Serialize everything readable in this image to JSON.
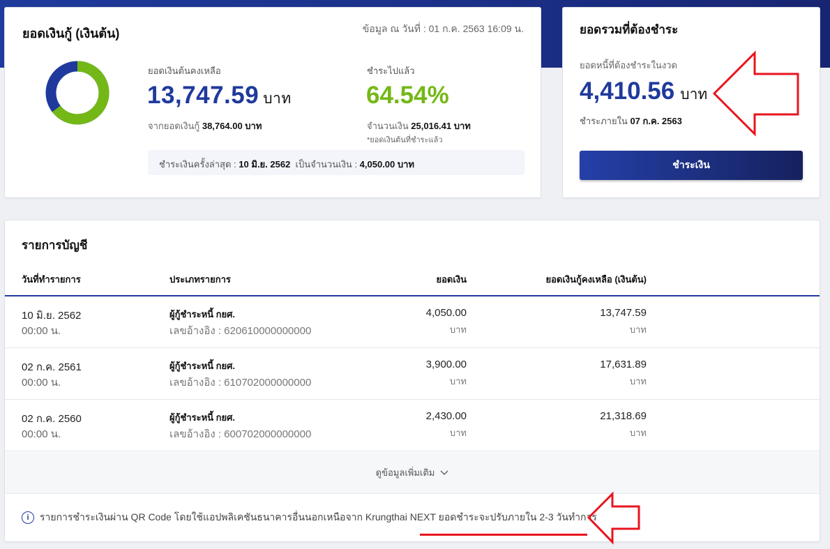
{
  "loan": {
    "title": "ยอดเงินกู้ (เงินต้น)",
    "as_of": "ข้อมูล ณ วันที่ : 01 ก.ค. 2563 16:09 น.",
    "remaining_label": "ยอดเงินต้นคงเหลือ",
    "remaining_amount": "13,747.59",
    "unit": "บาท",
    "from_label": "จากยอดเงินกู้",
    "from_amount": "38,764.00 บาท",
    "paid_label": "ชำระไปแล้ว",
    "paid_percent": "64.54%",
    "paid_fraction": 0.6454,
    "amount_label": "จำนวนเงิน",
    "amount_paid": "25,016.41 บาท",
    "note": "*ยอดเงินต้นที่ชำระแล้ว",
    "last_pay_label": "ชำระเงินครั้งล่าสุด :",
    "last_pay_date": "10 มิ.ย. 2562",
    "last_pay_amount_label": "เป็นจำนวนเงิน :",
    "last_pay_amount": "4,050.00 บาท"
  },
  "colors": {
    "accent": "#1f3a9c",
    "paid": "#74b817",
    "alert": "#e8141e"
  },
  "total": {
    "title": "ยอดรวมที่ต้องชำระ",
    "due_label": "ยอดหนี้ที่ต้องชำระในงวด",
    "amount": "4,410.56",
    "unit": "บาท",
    "due_date_label": "ชำระภายใน",
    "due_date": "07 ก.ค. 2563",
    "pay_button": "ชำระเงิน"
  },
  "transactions": {
    "title": "รายการบัญชี",
    "headers": [
      "วันที่ทำรายการ",
      "ประเภทรายการ",
      "ยอดเงิน",
      "ยอดเงินกู้คงเหลือ (เงินต้น)"
    ],
    "rows": [
      {
        "date": "10 มิ.ย. 2562",
        "time": "00:00 น.",
        "type": "ผู้กู้ชำระหนี้ กยศ.",
        "ref": "เลขอ้างอิง : 620610000000000",
        "amount": "4,050.00",
        "amount_unit": "บาท",
        "balance": "13,747.59",
        "balance_unit": "บาท"
      },
      {
        "date": "02 ก.ค. 2561",
        "time": "00:00 น.",
        "type": "ผู้กู้ชำระหนี้ กยศ.",
        "ref": "เลขอ้างอิง : 610702000000000",
        "amount": "3,900.00",
        "amount_unit": "บาท",
        "balance": "17,631.89",
        "balance_unit": "บาท"
      },
      {
        "date": "02 ก.ค. 2560",
        "time": "00:00 น.",
        "type": "ผู้กู้ชำระหนี้ กยศ.",
        "ref": "เลขอ้างอิง : 600702000000000",
        "amount": "2,430.00",
        "amount_unit": "บาท",
        "balance": "21,318.69",
        "balance_unit": "บาท"
      }
    ],
    "more_label": "ดูข้อมูลเพิ่มเติม",
    "info_icon": "info-icon",
    "info_text": "รายการชำระเงินผ่าน QR Code โดยใช้แอปพลิเคชันธนาคารอื่นนอกเหนือจาก Krungthai NEXT ยอดชำระจะปรับภายใน 2-3 วันทำการ"
  }
}
